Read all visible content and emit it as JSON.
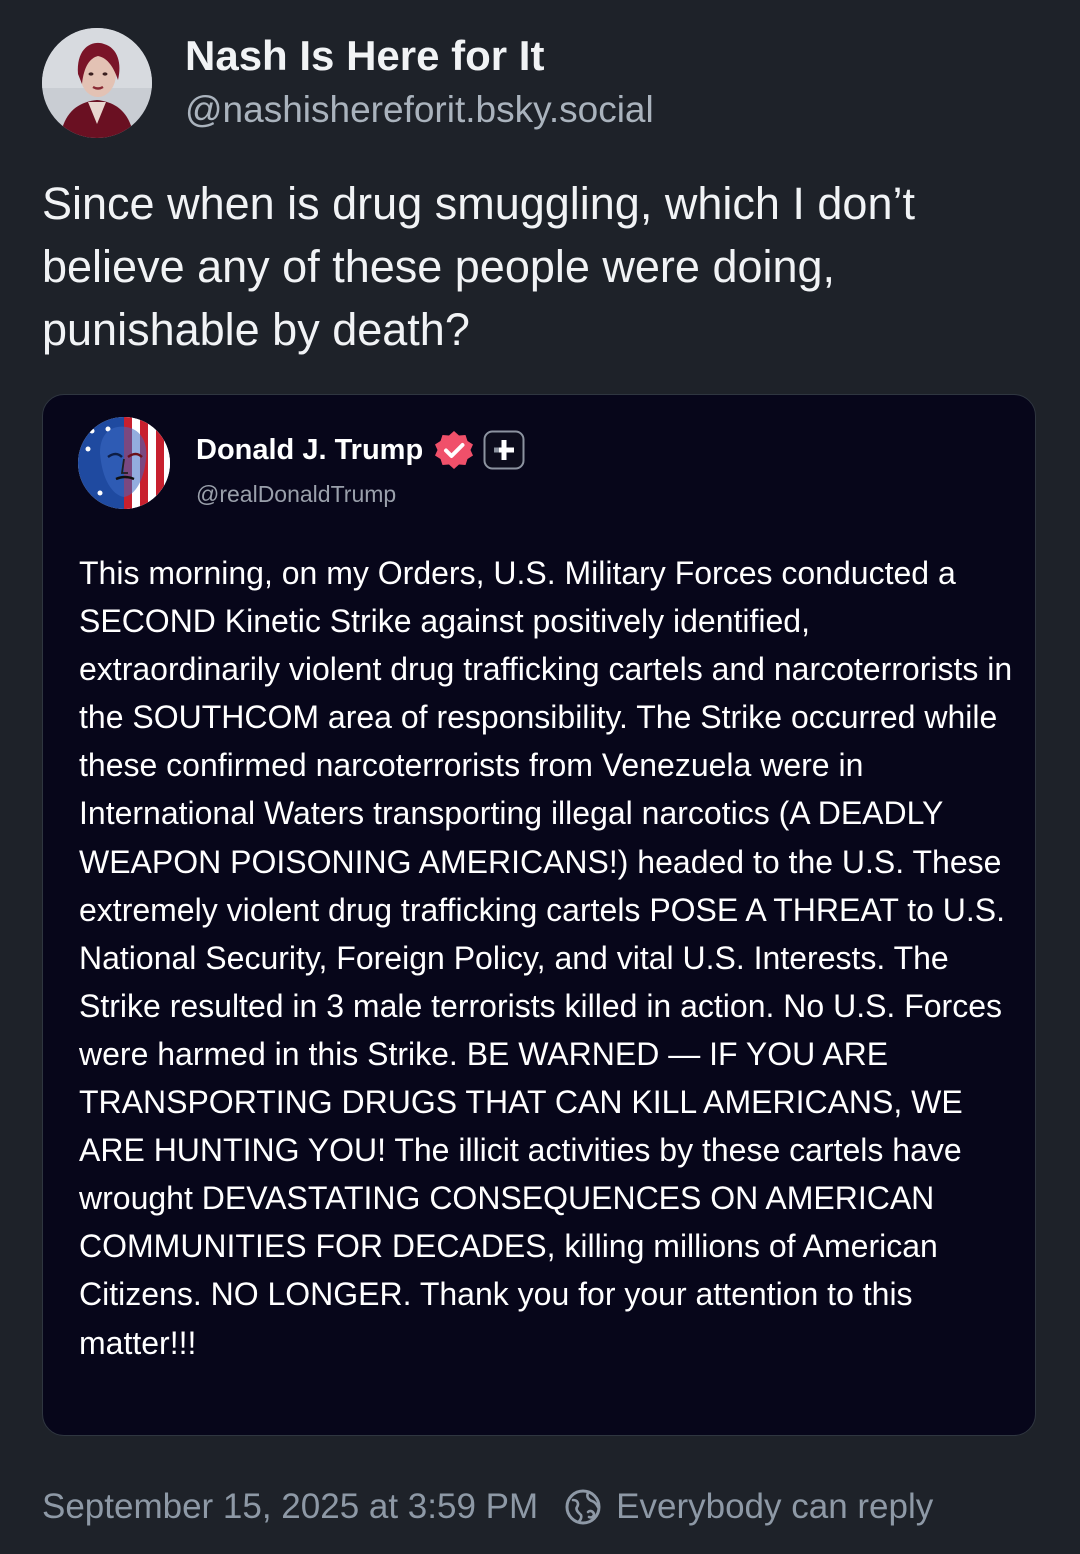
{
  "post": {
    "author": {
      "display_name": "Nash Is Here for It",
      "handle": "@nashishereforit.bsky.social"
    },
    "text": "Since when is drug smuggling, which I don’t believe any of these people were doing, punishable by death?",
    "timestamp": "September 15, 2025 at 3:59 PM",
    "reply_setting": "Everybody can reply"
  },
  "quote": {
    "author": {
      "display_name": "Donald J. Trump",
      "handle": "@realDonaldTrump",
      "verified_icon": "verified-badge-icon",
      "extra_icon": "plus-icon"
    },
    "text": "This morning, on my Orders, U.S. Military Forces conducted a SECOND Kinetic Strike against positively identified, extraordinarily violent drug trafficking cartels and narcoterrorists in the SOUTHCOM area of responsibility. The Strike occurred while these confirmed narcoterrorists from Venezuela were in International Waters transporting illegal narcotics (A DEADLY WEAPON POISONING AMERICANS!) headed to the U.S. These extremely violent drug trafficking cartels POSE A THREAT to U.S. National Security, Foreign Policy, and vital U.S. Interests. The Strike resulted in 3 male terrorists killed in action. No U.S. Forces were harmed in this Strike. BE WARNED — IF YOU ARE TRANSPORTING DRUGS THAT CAN KILL AMERICANS, WE ARE HUNTING YOU! The illicit activities by these cartels have wrought DEVASTATING CONSEQUENCES ON AMERICAN COMMUNITIES FOR DECADES, killing millions of American Citizens. NO LONGER. Thank you for your attention to this matter!!!"
  },
  "colors": {
    "background": "#1e2229",
    "quote_background": "#07061a",
    "verified": "#f0506a",
    "muted_text": "#8e99a6"
  }
}
